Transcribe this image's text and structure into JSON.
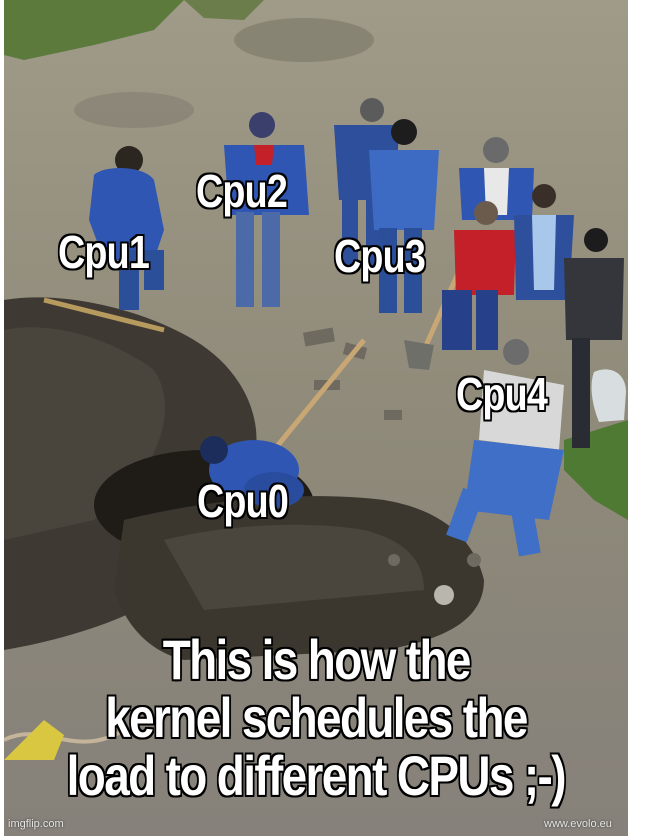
{
  "labels": {
    "cpu0": "Cpu0",
    "cpu1": "Cpu1",
    "cpu2": "Cpu2",
    "cpu3": "Cpu3",
    "cpu4": "Cpu4"
  },
  "caption": {
    "line1": "This is how the",
    "line2": "kernel schedules the",
    "line3": "load to different CPUs ;-)"
  },
  "watermarks": {
    "left": "imgflip.com",
    "right": "www.evolo.eu"
  },
  "colors": {
    "ground": "#8d8776",
    "dirt": "#3e3a33",
    "grass": "#5b7a3c",
    "workwear_blue": "#2f56b3",
    "red_jacket": "#c3202a"
  }
}
